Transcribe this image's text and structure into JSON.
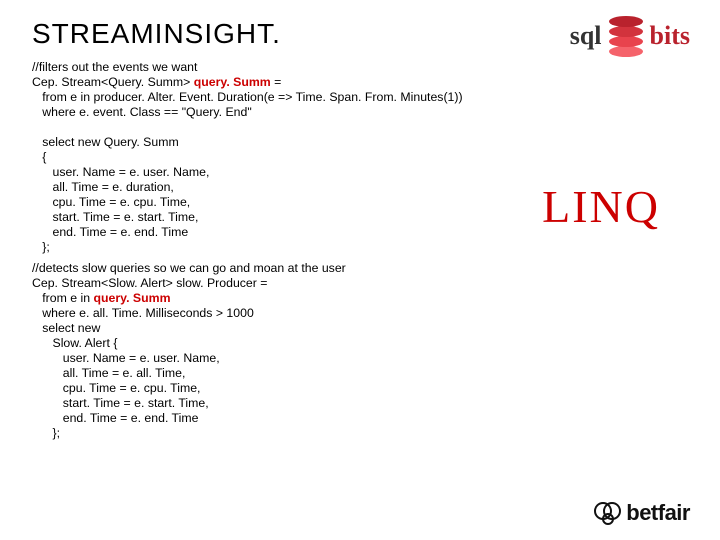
{
  "title": "STREAMINSIGHT.",
  "logo_sql": "sql",
  "logo_bits": "bits",
  "linq_label": "LINQ",
  "footer_logo_text": "betfair",
  "code_block1": {
    "c0": "//filters out the events we want",
    "c1a": "Cep. Stream<Query. Summ> ",
    "c1b": "query. Summ",
    "c1c": " =",
    "c2": "   from e in producer. Alter. Event. Duration(e => Time. Span. From. Minutes(1))",
    "c3": "   where e. event. Class == \"Query. End\"",
    "c4": "",
    "c5": "   select new Query. Summ",
    "c6": "   {",
    "c7": "      user. Name = e. user. Name,",
    "c8": "      all. Time = e. duration,",
    "c9": "      cpu. Time = e. cpu. Time,",
    "c10": "      start. Time = e. start. Time,",
    "c11": "      end. Time = e. end. Time",
    "c12": "   };"
  },
  "code_block2": {
    "d0": "//detects slow queries so we can go and moan at the user",
    "d1": "Cep. Stream<Slow. Alert> slow. Producer =",
    "d2a": "   from e in ",
    "d2b": "query. Summ",
    "d3": "   where e. all. Time. Milliseconds > 1000",
    "d4": "   select new",
    "d5": "      Slow. Alert {",
    "d6": "         user. Name = e. user. Name,",
    "d7": "         all. Time = e. all. Time,",
    "d8": "         cpu. Time = e. cpu. Time,",
    "d9": "         start. Time = e. start. Time,",
    "d10": "         end. Time = e. end. Time",
    "d11": "      };"
  }
}
